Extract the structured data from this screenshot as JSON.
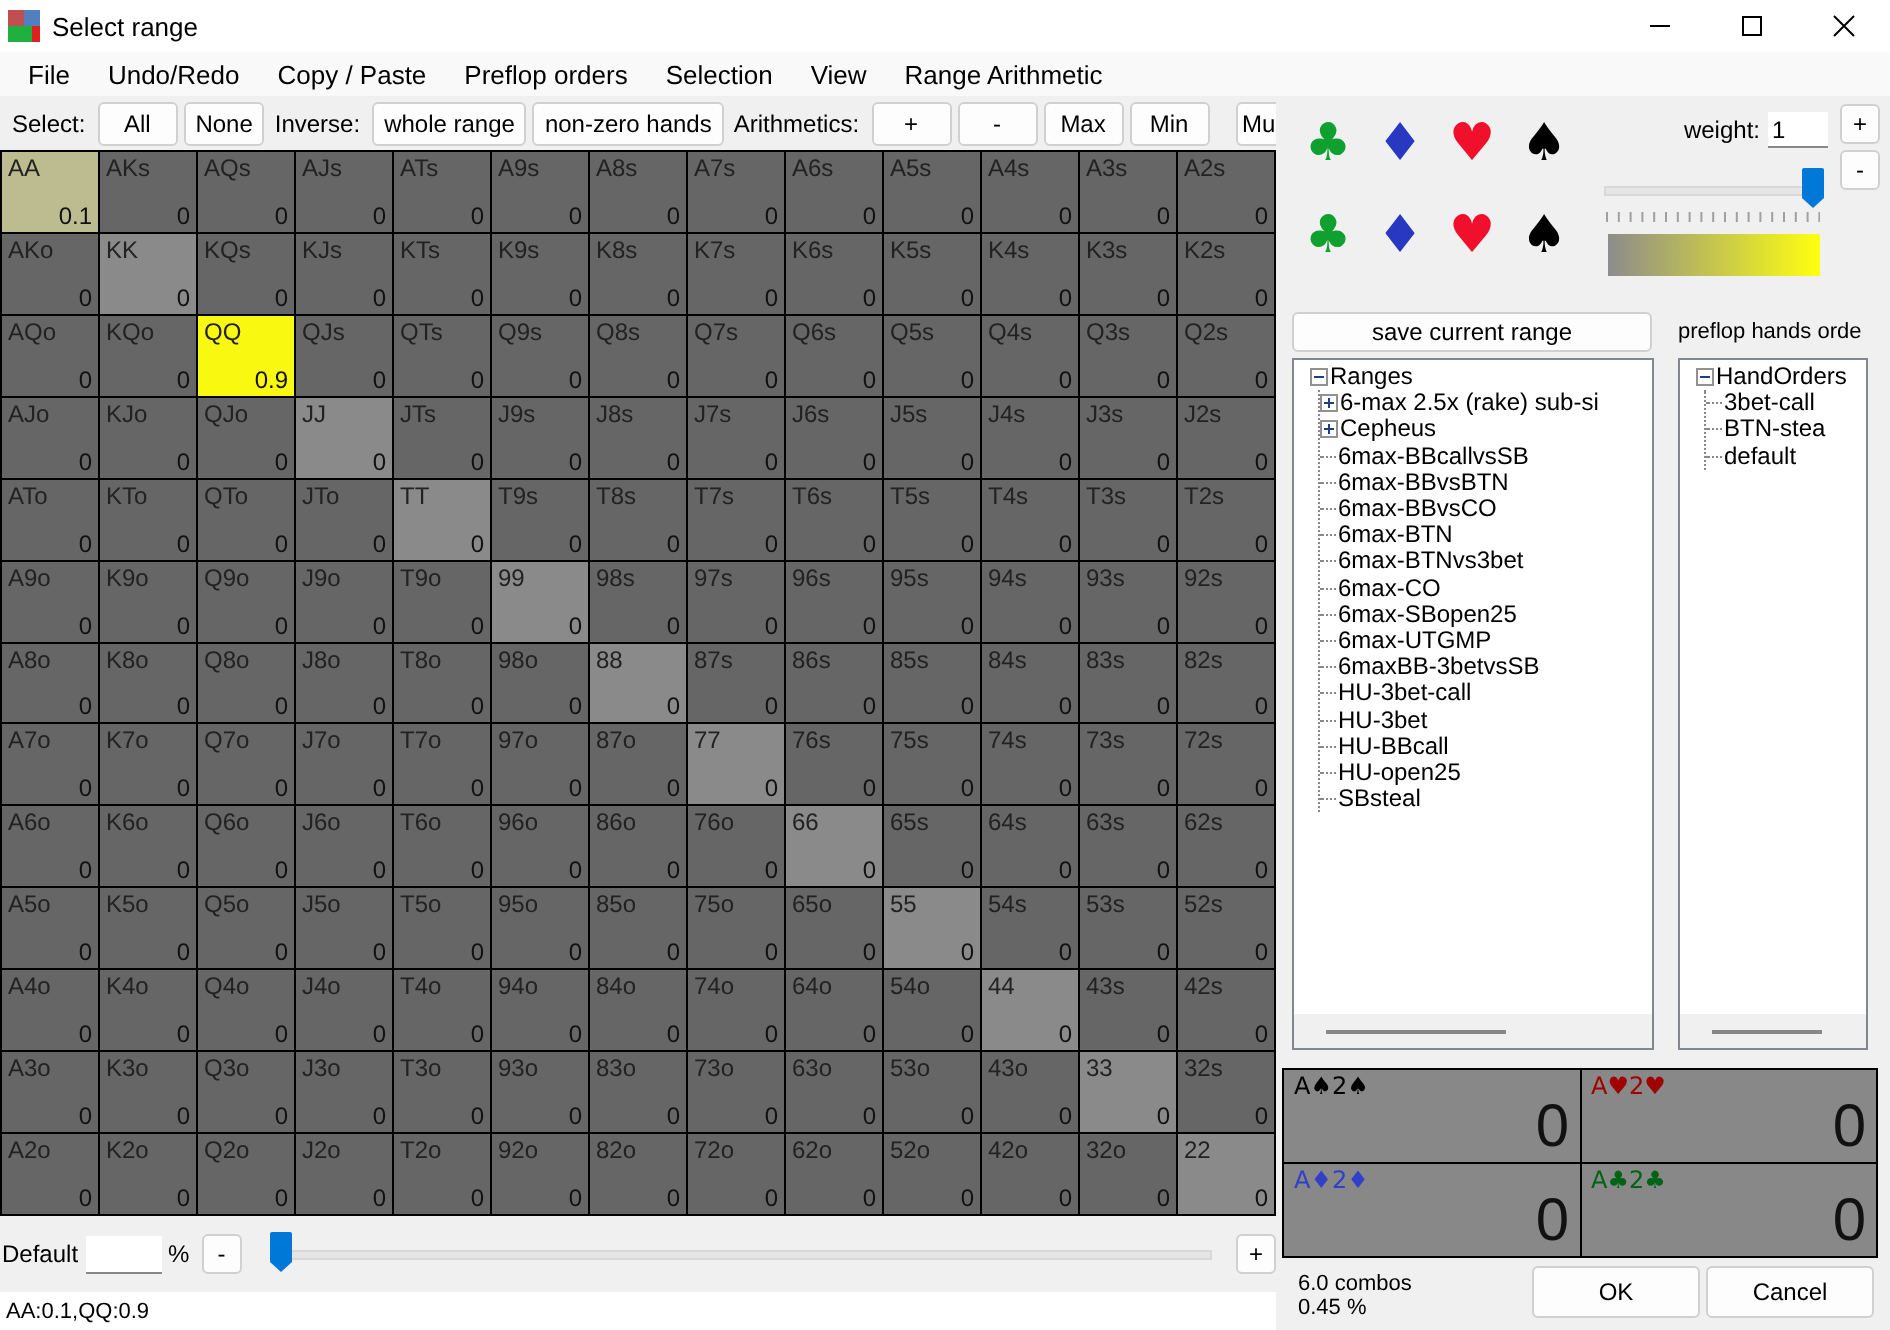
{
  "window": {
    "title": "Select range"
  },
  "menu": [
    "File",
    "Undo/Redo",
    "Copy / Paste",
    "Preflop orders",
    "Selection",
    "View",
    "Range Arithmetic"
  ],
  "toolbar": [
    {
      "kind": "label",
      "text": "Select:"
    },
    {
      "kind": "button",
      "text": "All"
    },
    {
      "kind": "button",
      "text": "None"
    },
    {
      "kind": "label",
      "text": "Inverse:"
    },
    {
      "kind": "button",
      "text": "whole range"
    },
    {
      "kind": "button",
      "text": "non-zero hands"
    },
    {
      "kind": "label",
      "text": "Arithmetics:"
    },
    {
      "kind": "button",
      "text": "+"
    },
    {
      "kind": "button",
      "text": "-"
    },
    {
      "kind": "button",
      "text": "Max"
    },
    {
      "kind": "button",
      "text": "Min"
    },
    {
      "kind": "button",
      "text": "Mu"
    }
  ],
  "grid": [
    [
      {
        "hand": "AA",
        "kind": "pair",
        "value": "0.1"
      },
      {
        "hand": "AKs",
        "kind": "suited",
        "value": "0"
      },
      {
        "hand": "AQs",
        "kind": "suited",
        "value": "0"
      },
      {
        "hand": "AJs",
        "kind": "suited",
        "value": "0"
      },
      {
        "hand": "ATs",
        "kind": "suited",
        "value": "0"
      },
      {
        "hand": "A9s",
        "kind": "suited",
        "value": "0"
      },
      {
        "hand": "A8s",
        "kind": "suited",
        "value": "0"
      },
      {
        "hand": "A7s",
        "kind": "suited",
        "value": "0"
      },
      {
        "hand": "A6s",
        "kind": "suited",
        "value": "0"
      },
      {
        "hand": "A5s",
        "kind": "suited",
        "value": "0"
      },
      {
        "hand": "A4s",
        "kind": "suited",
        "value": "0"
      },
      {
        "hand": "A3s",
        "kind": "suited",
        "value": "0"
      },
      {
        "hand": "A2s",
        "kind": "suited",
        "value": "0"
      }
    ],
    [
      {
        "hand": "AKo",
        "kind": "offsuit",
        "value": "0"
      },
      {
        "hand": "KK",
        "kind": "pair",
        "value": "0"
      },
      {
        "hand": "KQs",
        "kind": "suited",
        "value": "0"
      },
      {
        "hand": "KJs",
        "kind": "suited",
        "value": "0"
      },
      {
        "hand": "KTs",
        "kind": "suited",
        "value": "0"
      },
      {
        "hand": "K9s",
        "kind": "suited",
        "value": "0"
      },
      {
        "hand": "K8s",
        "kind": "suited",
        "value": "0"
      },
      {
        "hand": "K7s",
        "kind": "suited",
        "value": "0"
      },
      {
        "hand": "K6s",
        "kind": "suited",
        "value": "0"
      },
      {
        "hand": "K5s",
        "kind": "suited",
        "value": "0"
      },
      {
        "hand": "K4s",
        "kind": "suited",
        "value": "0"
      },
      {
        "hand": "K3s",
        "kind": "suited",
        "value": "0"
      },
      {
        "hand": "K2s",
        "kind": "suited",
        "value": "0"
      }
    ],
    [
      {
        "hand": "AQo",
        "kind": "offsuit",
        "value": "0"
      },
      {
        "hand": "KQo",
        "kind": "offsuit",
        "value": "0"
      },
      {
        "hand": "QQ",
        "kind": "pair",
        "value": "0.9"
      },
      {
        "hand": "QJs",
        "kind": "suited",
        "value": "0"
      },
      {
        "hand": "QTs",
        "kind": "suited",
        "value": "0"
      },
      {
        "hand": "Q9s",
        "kind": "suited",
        "value": "0"
      },
      {
        "hand": "Q8s",
        "kind": "suited",
        "value": "0"
      },
      {
        "hand": "Q7s",
        "kind": "suited",
        "value": "0"
      },
      {
        "hand": "Q6s",
        "kind": "suited",
        "value": "0"
      },
      {
        "hand": "Q5s",
        "kind": "suited",
        "value": "0"
      },
      {
        "hand": "Q4s",
        "kind": "suited",
        "value": "0"
      },
      {
        "hand": "Q3s",
        "kind": "suited",
        "value": "0"
      },
      {
        "hand": "Q2s",
        "kind": "suited",
        "value": "0"
      }
    ],
    [
      {
        "hand": "AJo",
        "kind": "offsuit",
        "value": "0"
      },
      {
        "hand": "KJo",
        "kind": "offsuit",
        "value": "0"
      },
      {
        "hand": "QJo",
        "kind": "offsuit",
        "value": "0"
      },
      {
        "hand": "JJ",
        "kind": "pair",
        "value": "0"
      },
      {
        "hand": "JTs",
        "kind": "suited",
        "value": "0"
      },
      {
        "hand": "J9s",
        "kind": "suited",
        "value": "0"
      },
      {
        "hand": "J8s",
        "kind": "suited",
        "value": "0"
      },
      {
        "hand": "J7s",
        "kind": "suited",
        "value": "0"
      },
      {
        "hand": "J6s",
        "kind": "suited",
        "value": "0"
      },
      {
        "hand": "J5s",
        "kind": "suited",
        "value": "0"
      },
      {
        "hand": "J4s",
        "kind": "suited",
        "value": "0"
      },
      {
        "hand": "J3s",
        "kind": "suited",
        "value": "0"
      },
      {
        "hand": "J2s",
        "kind": "suited",
        "value": "0"
      }
    ],
    [
      {
        "hand": "ATo",
        "kind": "offsuit",
        "value": "0"
      },
      {
        "hand": "KTo",
        "kind": "offsuit",
        "value": "0"
      },
      {
        "hand": "QTo",
        "kind": "offsuit",
        "value": "0"
      },
      {
        "hand": "JTo",
        "kind": "offsuit",
        "value": "0"
      },
      {
        "hand": "TT",
        "kind": "pair",
        "value": "0"
      },
      {
        "hand": "T9s",
        "kind": "suited",
        "value": "0"
      },
      {
        "hand": "T8s",
        "kind": "suited",
        "value": "0"
      },
      {
        "hand": "T7s",
        "kind": "suited",
        "value": "0"
      },
      {
        "hand": "T6s",
        "kind": "suited",
        "value": "0"
      },
      {
        "hand": "T5s",
        "kind": "suited",
        "value": "0"
      },
      {
        "hand": "T4s",
        "kind": "suited",
        "value": "0"
      },
      {
        "hand": "T3s",
        "kind": "suited",
        "value": "0"
      },
      {
        "hand": "T2s",
        "kind": "suited",
        "value": "0"
      }
    ],
    [
      {
        "hand": "A9o",
        "kind": "offsuit",
        "value": "0"
      },
      {
        "hand": "K9o",
        "kind": "offsuit",
        "value": "0"
      },
      {
        "hand": "Q9o",
        "kind": "offsuit",
        "value": "0"
      },
      {
        "hand": "J9o",
        "kind": "offsuit",
        "value": "0"
      },
      {
        "hand": "T9o",
        "kind": "offsuit",
        "value": "0"
      },
      {
        "hand": "99",
        "kind": "pair",
        "value": "0"
      },
      {
        "hand": "98s",
        "kind": "suited",
        "value": "0"
      },
      {
        "hand": "97s",
        "kind": "suited",
        "value": "0"
      },
      {
        "hand": "96s",
        "kind": "suited",
        "value": "0"
      },
      {
        "hand": "95s",
        "kind": "suited",
        "value": "0"
      },
      {
        "hand": "94s",
        "kind": "suited",
        "value": "0"
      },
      {
        "hand": "93s",
        "kind": "suited",
        "value": "0"
      },
      {
        "hand": "92s",
        "kind": "suited",
        "value": "0"
      }
    ],
    [
      {
        "hand": "A8o",
        "kind": "offsuit",
        "value": "0"
      },
      {
        "hand": "K8o",
        "kind": "offsuit",
        "value": "0"
      },
      {
        "hand": "Q8o",
        "kind": "offsuit",
        "value": "0"
      },
      {
        "hand": "J8o",
        "kind": "offsuit",
        "value": "0"
      },
      {
        "hand": "T8o",
        "kind": "offsuit",
        "value": "0"
      },
      {
        "hand": "98o",
        "kind": "offsuit",
        "value": "0"
      },
      {
        "hand": "88",
        "kind": "pair",
        "value": "0"
      },
      {
        "hand": "87s",
        "kind": "suited",
        "value": "0"
      },
      {
        "hand": "86s",
        "kind": "suited",
        "value": "0"
      },
      {
        "hand": "85s",
        "kind": "suited",
        "value": "0"
      },
      {
        "hand": "84s",
        "kind": "suited",
        "value": "0"
      },
      {
        "hand": "83s",
        "kind": "suited",
        "value": "0"
      },
      {
        "hand": "82s",
        "kind": "suited",
        "value": "0"
      }
    ],
    [
      {
        "hand": "A7o",
        "kind": "offsuit",
        "value": "0"
      },
      {
        "hand": "K7o",
        "kind": "offsuit",
        "value": "0"
      },
      {
        "hand": "Q7o",
        "kind": "offsuit",
        "value": "0"
      },
      {
        "hand": "J7o",
        "kind": "offsuit",
        "value": "0"
      },
      {
        "hand": "T7o",
        "kind": "offsuit",
        "value": "0"
      },
      {
        "hand": "97o",
        "kind": "offsuit",
        "value": "0"
      },
      {
        "hand": "87o",
        "kind": "offsuit",
        "value": "0"
      },
      {
        "hand": "77",
        "kind": "pair",
        "value": "0"
      },
      {
        "hand": "76s",
        "kind": "suited",
        "value": "0"
      },
      {
        "hand": "75s",
        "kind": "suited",
        "value": "0"
      },
      {
        "hand": "74s",
        "kind": "suited",
        "value": "0"
      },
      {
        "hand": "73s",
        "kind": "suited",
        "value": "0"
      },
      {
        "hand": "72s",
        "kind": "suited",
        "value": "0"
      }
    ],
    [
      {
        "hand": "A6o",
        "kind": "offsuit",
        "value": "0"
      },
      {
        "hand": "K6o",
        "kind": "offsuit",
        "value": "0"
      },
      {
        "hand": "Q6o",
        "kind": "offsuit",
        "value": "0"
      },
      {
        "hand": "J6o",
        "kind": "offsuit",
        "value": "0"
      },
      {
        "hand": "T6o",
        "kind": "offsuit",
        "value": "0"
      },
      {
        "hand": "96o",
        "kind": "offsuit",
        "value": "0"
      },
      {
        "hand": "86o",
        "kind": "offsuit",
        "value": "0"
      },
      {
        "hand": "76o",
        "kind": "offsuit",
        "value": "0"
      },
      {
        "hand": "66",
        "kind": "pair",
        "value": "0"
      },
      {
        "hand": "65s",
        "kind": "suited",
        "value": "0"
      },
      {
        "hand": "64s",
        "kind": "suited",
        "value": "0"
      },
      {
        "hand": "63s",
        "kind": "suited",
        "value": "0"
      },
      {
        "hand": "62s",
        "kind": "suited",
        "value": "0"
      }
    ],
    [
      {
        "hand": "A5o",
        "kind": "offsuit",
        "value": "0"
      },
      {
        "hand": "K5o",
        "kind": "offsuit",
        "value": "0"
      },
      {
        "hand": "Q5o",
        "kind": "offsuit",
        "value": "0"
      },
      {
        "hand": "J5o",
        "kind": "offsuit",
        "value": "0"
      },
      {
        "hand": "T5o",
        "kind": "offsuit",
        "value": "0"
      },
      {
        "hand": "95o",
        "kind": "offsuit",
        "value": "0"
      },
      {
        "hand": "85o",
        "kind": "offsuit",
        "value": "0"
      },
      {
        "hand": "75o",
        "kind": "offsuit",
        "value": "0"
      },
      {
        "hand": "65o",
        "kind": "offsuit",
        "value": "0"
      },
      {
        "hand": "55",
        "kind": "pair",
        "value": "0"
      },
      {
        "hand": "54s",
        "kind": "suited",
        "value": "0"
      },
      {
        "hand": "53s",
        "kind": "suited",
        "value": "0"
      },
      {
        "hand": "52s",
        "kind": "suited",
        "value": "0"
      }
    ],
    [
      {
        "hand": "A4o",
        "kind": "offsuit",
        "value": "0"
      },
      {
        "hand": "K4o",
        "kind": "offsuit",
        "value": "0"
      },
      {
        "hand": "Q4o",
        "kind": "offsuit",
        "value": "0"
      },
      {
        "hand": "J4o",
        "kind": "offsuit",
        "value": "0"
      },
      {
        "hand": "T4o",
        "kind": "offsuit",
        "value": "0"
      },
      {
        "hand": "94o",
        "kind": "offsuit",
        "value": "0"
      },
      {
        "hand": "84o",
        "kind": "offsuit",
        "value": "0"
      },
      {
        "hand": "74o",
        "kind": "offsuit",
        "value": "0"
      },
      {
        "hand": "64o",
        "kind": "offsuit",
        "value": "0"
      },
      {
        "hand": "54o",
        "kind": "offsuit",
        "value": "0"
      },
      {
        "hand": "44",
        "kind": "pair",
        "value": "0"
      },
      {
        "hand": "43s",
        "kind": "suited",
        "value": "0"
      },
      {
        "hand": "42s",
        "kind": "suited",
        "value": "0"
      }
    ],
    [
      {
        "hand": "A3o",
        "kind": "offsuit",
        "value": "0"
      },
      {
        "hand": "K3o",
        "kind": "offsuit",
        "value": "0"
      },
      {
        "hand": "Q3o",
        "kind": "offsuit",
        "value": "0"
      },
      {
        "hand": "J3o",
        "kind": "offsuit",
        "value": "0"
      },
      {
        "hand": "T3o",
        "kind": "offsuit",
        "value": "0"
      },
      {
        "hand": "93o",
        "kind": "offsuit",
        "value": "0"
      },
      {
        "hand": "83o",
        "kind": "offsuit",
        "value": "0"
      },
      {
        "hand": "73o",
        "kind": "offsuit",
        "value": "0"
      },
      {
        "hand": "63o",
        "kind": "offsuit",
        "value": "0"
      },
      {
        "hand": "53o",
        "kind": "offsuit",
        "value": "0"
      },
      {
        "hand": "43o",
        "kind": "offsuit",
        "value": "0"
      },
      {
        "hand": "33",
        "kind": "pair",
        "value": "0"
      },
      {
        "hand": "32s",
        "kind": "suited",
        "value": "0"
      }
    ],
    [
      {
        "hand": "A2o",
        "kind": "offsuit",
        "value": "0"
      },
      {
        "hand": "K2o",
        "kind": "offsuit",
        "value": "0"
      },
      {
        "hand": "Q2o",
        "kind": "offsuit",
        "value": "0"
      },
      {
        "hand": "J2o",
        "kind": "offsuit",
        "value": "0"
      },
      {
        "hand": "T2o",
        "kind": "offsuit",
        "value": "0"
      },
      {
        "hand": "92o",
        "kind": "offsuit",
        "value": "0"
      },
      {
        "hand": "82o",
        "kind": "offsuit",
        "value": "0"
      },
      {
        "hand": "72o",
        "kind": "offsuit",
        "value": "0"
      },
      {
        "hand": "62o",
        "kind": "offsuit",
        "value": "0"
      },
      {
        "hand": "52o",
        "kind": "offsuit",
        "value": "0"
      },
      {
        "hand": "42o",
        "kind": "offsuit",
        "value": "0"
      },
      {
        "hand": "32o",
        "kind": "offsuit",
        "value": "0"
      },
      {
        "hand": "22",
        "kind": "pair",
        "value": "0"
      }
    ]
  ],
  "default_control": {
    "label": "Default",
    "percent": "%",
    "minus": "-",
    "plus": "+"
  },
  "status_bar": "AA:0.1,QQ:0.9",
  "suit_rows": [
    [
      {
        "symbol": "♣",
        "color": "#10a030"
      },
      {
        "symbol": "♦",
        "color": "#2838c0"
      },
      {
        "symbol": "♥",
        "color": "#f0102c"
      },
      {
        "symbol": "♠",
        "color": "#000000"
      }
    ],
    [
      {
        "symbol": "♣",
        "color": "#10a030"
      },
      {
        "symbol": "♦",
        "color": "#2838c0"
      },
      {
        "symbol": "♥",
        "color": "#f0102c"
      },
      {
        "symbol": "♠",
        "color": "#000000"
      }
    ]
  ],
  "weight": {
    "label": "weight:",
    "value": "1",
    "plus": "+",
    "minus": "-",
    "level": 1
  },
  "save_button": "save current range",
  "orders_heading": "preflop hands orde",
  "ranges_tree": [
    {
      "label": "Ranges",
      "expanded": true,
      "children": [
        {
          "label": "6-max 2.5x (rake) sub-si",
          "expanded": false
        },
        {
          "label": "Cepheus",
          "expanded": false
        },
        {
          "label": "6max-BBcallvsSB"
        },
        {
          "label": "6max-BBvsBTN"
        },
        {
          "label": "6max-BBvsCO"
        },
        {
          "label": "6max-BTN"
        },
        {
          "label": "6max-BTNvs3bet"
        },
        {
          "label": "6max-CO"
        },
        {
          "label": "6max-SBopen25"
        },
        {
          "label": "6max-UTGMP"
        },
        {
          "label": "6maxBB-3betvsSB"
        },
        {
          "label": "HU-3bet-call"
        },
        {
          "label": "HU-3bet"
        },
        {
          "label": "HU-BBcall"
        },
        {
          "label": "HU-open25"
        },
        {
          "label": "SBsteal"
        }
      ]
    }
  ],
  "orders_tree": [
    {
      "label": "HandOrders",
      "expanded": true,
      "children": [
        {
          "label": "3bet-call"
        },
        {
          "label": "BTN-stea"
        },
        {
          "label": "default"
        }
      ]
    }
  ],
  "combos": [
    {
      "label": "A♠2♠",
      "color": "#000000",
      "value": "0"
    },
    {
      "label": "A♥2♥",
      "color": "#a00000",
      "value": "0"
    },
    {
      "label": "A♦2♦",
      "color": "#3040c8",
      "value": "0"
    },
    {
      "label": "A♣2♣",
      "color": "#006414",
      "value": "0"
    }
  ],
  "summary": {
    "combos": "6.0 combos",
    "percent": "0.45 %"
  },
  "buttons": [
    "OK",
    "Cancel"
  ]
}
